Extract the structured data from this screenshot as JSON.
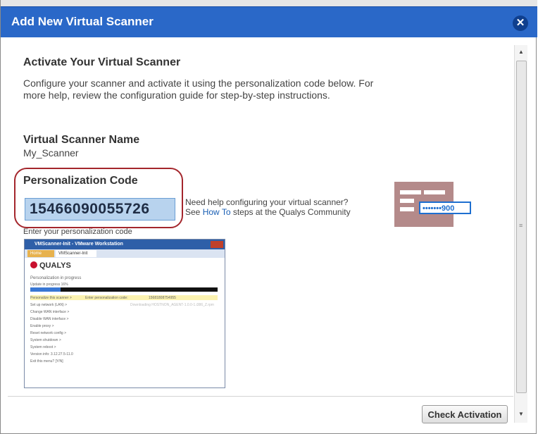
{
  "dialog": {
    "title": "Add New Virtual Scanner",
    "close_icon": "close-icon"
  },
  "activate": {
    "heading": "Activate Your Virtual Scanner",
    "line1": "Configure your scanner and activate it using the personalization code below. For",
    "line2": "more help, review the configuration guide for step-by-step instructions."
  },
  "scanner_name": {
    "label": "Virtual Scanner Name",
    "value": "My_Scanner"
  },
  "personalization": {
    "label": "Personalization Code",
    "code": "15466090055726",
    "help_line1": "Need help configuring your virtual scanner?",
    "help_prefix": "See",
    "help_link": "How To",
    "help_suffix": "steps at the Qualys Community",
    "caption": "Enter your personalization code"
  },
  "illustration": {
    "mask_text": "•••••••900"
  },
  "embedded_screenshot": {
    "window_title": "VMScanner-Init - VMware Workstation",
    "tab_home": "Home",
    "tab_vm": "VMScanner-Init",
    "brand": "QUALYS",
    "status": "Personalization in progress",
    "progress_text": "Update in progress 16%",
    "progress_value": 0.16,
    "menu_personalize": "Personalize this scanner >",
    "menu_enter": "Enter personalization code:",
    "menu_code": "15681808754955",
    "menu_items": [
      "Set up network (LAN) >",
      "Change WAN interface >",
      "Disable WAN interface >",
      "Enable proxy >",
      "Reset network config >",
      "System shutdown >",
      "System reboot >",
      "Version info: 3.12.27.5-11.0",
      "Exit this menu? [Y/N]"
    ],
    "download_text": "Downloading HOSTNON_AGENT-1.0.0-1.i386_Z.rpm"
  },
  "footer": {
    "check_label": "Check Activation"
  },
  "colors": {
    "titlebar": "#2a68c8",
    "code_bg": "#b8d3ee",
    "highlight_ring": "#a4262c",
    "link": "#1a5fb4",
    "icon_brown": "#b48a8a",
    "icon_blue": "#1e6fd0"
  }
}
